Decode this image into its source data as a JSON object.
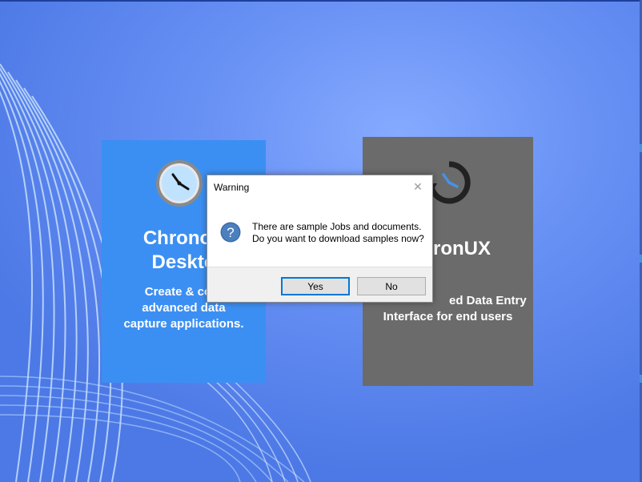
{
  "colors": {
    "studio_tile": "#3c8ff2",
    "ux_tile": "#6b6b6b",
    "desktop_bg": "#6a93f5",
    "dialog_bg": "#f0f0f0",
    "question_icon": "#3a6ea8"
  },
  "tiles": {
    "studio": {
      "icon": "clock-icon",
      "title_line1": "ChronoS",
      "title_line2": "Deskto",
      "desc_line1": "Create & conf",
      "desc_line2": "advanced data",
      "desc_line3": "capture applications."
    },
    "ux": {
      "icon": "clock-refresh-icon",
      "title": "ronUX",
      "desc_line1": "ed Data Entry",
      "desc_line2": "Interface for end users"
    }
  },
  "dialog": {
    "title": "Warning",
    "close_icon": "close-icon",
    "message_icon": "question-icon",
    "message_line1": "There are sample Jobs and documents.",
    "message_line2": "Do you want to download samples now?",
    "yes_label": "Yes",
    "no_label": "No"
  }
}
